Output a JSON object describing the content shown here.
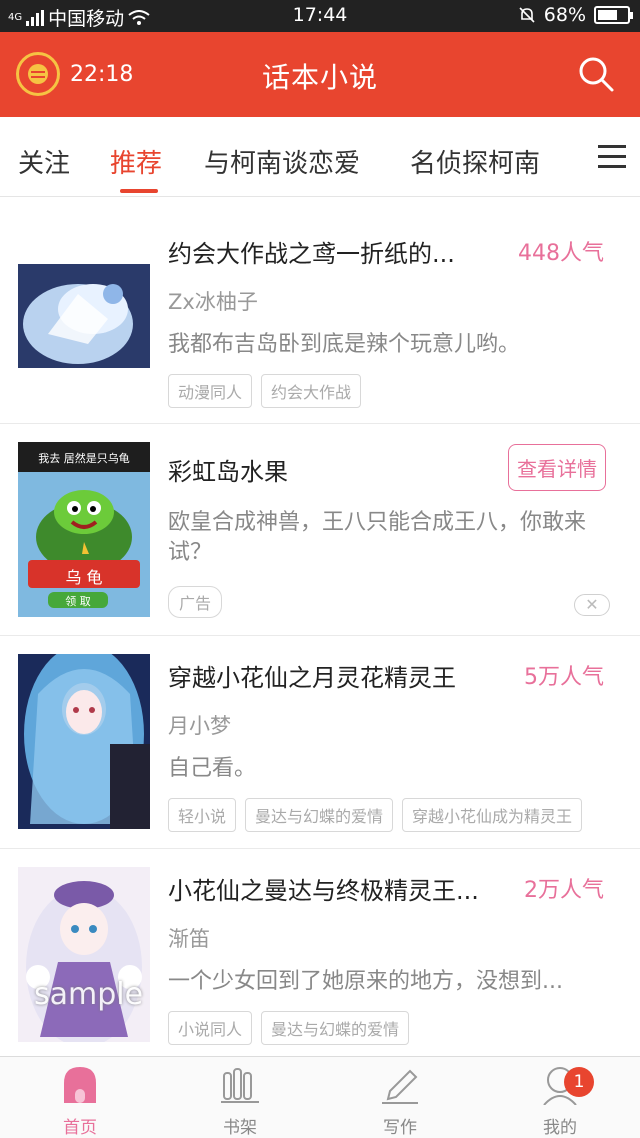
{
  "status_bar": {
    "network": "4G",
    "carrier": "中国移动",
    "time": "17:44",
    "battery": "68%",
    "battery_level": 0.68
  },
  "header": {
    "timer": "22:18",
    "title": "话本小说",
    "icons": [
      "alarm-coin-icon",
      "search-icon"
    ]
  },
  "tabs": [
    {
      "label": "关注",
      "active": false
    },
    {
      "label": "推荐",
      "active": true
    },
    {
      "label": "与柯南谈恋爱",
      "active": false
    },
    {
      "label": "名侦探柯南",
      "active": false
    },
    {
      "label": "",
      "active": false
    }
  ],
  "feed": [
    {
      "title": "约会大作战之鸢一折纸的...",
      "popularity": "448人气",
      "author": "Zx冰柚子",
      "description": "我都布吉岛卧到底是辣个玩意儿哟。",
      "tags": [
        "动漫同人",
        "约会大作战"
      ]
    },
    {
      "title": "彩虹岛水果",
      "detail_button": "查看详情",
      "description": "欧皇合成神兽，王八只能合成王八，你敢来试？",
      "ad_label": "广告",
      "close_symbol": "✕",
      "cover_text": {
        "top": "我去 居然是只乌龟",
        "banner": "乌 龟",
        "button": "领 取"
      }
    },
    {
      "title": "穿越小花仙之月灵花精灵王",
      "popularity": "5万人气",
      "author": "月小梦",
      "description": "自己看。",
      "tags": [
        "轻小说",
        "曼达与幻蝶的爱情",
        "穿越小花仙成为精灵王"
      ]
    },
    {
      "title": "小花仙之曼达与终极精灵王...",
      "popularity": "2万人气",
      "author": "渐笛",
      "description": "一个少女回到了她原来的地方，没想到...",
      "tags": [
        "小说同人",
        "曼达与幻蝶的爱情"
      ],
      "cover_text": {
        "watermark": "sample"
      }
    }
  ],
  "bottom_nav": [
    {
      "label": "首页",
      "icon": "home-icon",
      "active": true
    },
    {
      "label": "书架",
      "icon": "bookshelf-icon",
      "active": false
    },
    {
      "label": "写作",
      "icon": "pencil-icon",
      "active": false
    },
    {
      "label": "我的",
      "icon": "profile-icon",
      "active": false,
      "badge": "1"
    }
  ],
  "colors": {
    "header": "#e8452f",
    "accent": "#e8709a",
    "active_tab": "#e8452f"
  }
}
